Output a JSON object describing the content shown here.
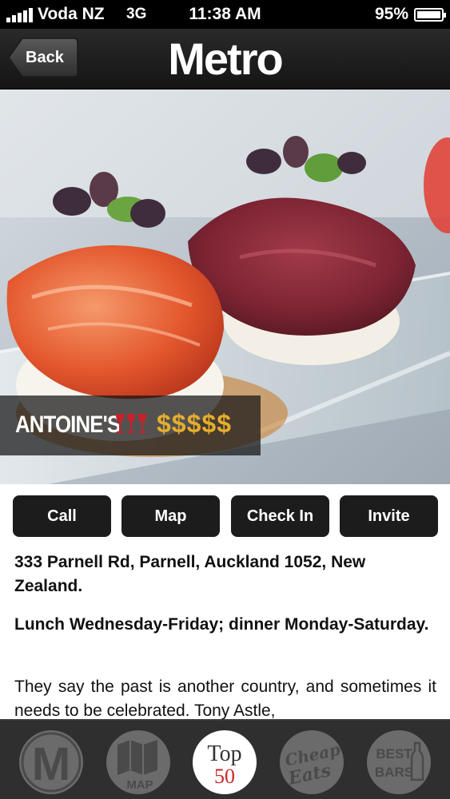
{
  "status_bar": {
    "carrier": "Voda NZ",
    "network": "3G",
    "time": "11:38 AM",
    "battery": "95%"
  },
  "nav": {
    "back_label": "Back",
    "title": "Metro"
  },
  "restaurant": {
    "name": "ANTOINE'S",
    "price": "$$$$$",
    "glasses_icon": "wine-glasses-icon",
    "glasses_color": "#c6222b",
    "price_color": "#e6ad2e"
  },
  "actions": [
    {
      "label": "Call"
    },
    {
      "label": "Map"
    },
    {
      "label": "Check In"
    },
    {
      "label": "Invite"
    }
  ],
  "details": {
    "address": "333 Parnell Rd, Parnell, Auckland 1052, New Zealand.",
    "hours": "Lunch Wednesday-Friday; dinner Monday-Saturday.",
    "description": "They say the past is another country, and sometimes it needs to be celebrated. Tony Astle,"
  },
  "tab_bar": {
    "items": [
      {
        "id": "metro",
        "icon": "metro-m-icon",
        "text": "M"
      },
      {
        "id": "map",
        "icon": "map-icon",
        "text": "MAP"
      },
      {
        "id": "top50",
        "icon": "top-50-icon",
        "text_line1": "Top",
        "text_line2": "50"
      },
      {
        "id": "cheap-eats",
        "icon": "cheap-eats-icon",
        "text_line1": "Cheap",
        "text_line2": "Eats"
      },
      {
        "id": "best-bars",
        "icon": "best-bars-icon",
        "text_line1": "BEST",
        "text_line2": "BARS"
      }
    ],
    "active": "top50"
  }
}
